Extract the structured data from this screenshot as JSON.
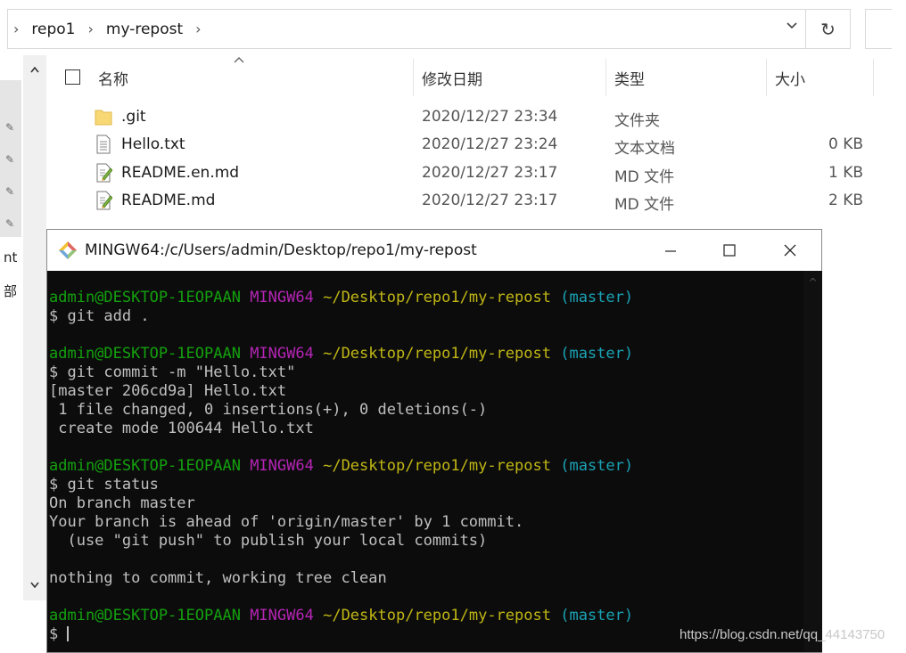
{
  "breadcrumb": [
    "repo1",
    "my-repost"
  ],
  "columns": {
    "name": "名称",
    "modified": "修改日期",
    "type": "类型",
    "size": "大小"
  },
  "files": [
    {
      "name": ".git",
      "modified": "2020/12/27 23:34",
      "type": "文件夹",
      "size": "",
      "icon": "folder-icon"
    },
    {
      "name": "Hello.txt",
      "modified": "2020/12/27 23:24",
      "type": "文本文档",
      "size": "0 KB",
      "icon": "text-file-icon"
    },
    {
      "name": "README.en.md",
      "modified": "2020/12/27 23:17",
      "type": "MD 文件",
      "size": "1 KB",
      "icon": "md-file-icon"
    },
    {
      "name": "README.md",
      "modified": "2020/12/27 23:17",
      "type": "MD 文件",
      "size": "2 KB",
      "icon": "md-file-icon"
    }
  ],
  "nav_clipped": [
    "nt",
    "部"
  ],
  "terminal": {
    "title": "MINGW64:/c/Users/admin/Desktop/repo1/my-repost",
    "prompt": {
      "user": "admin@DESKTOP-1EOPAAN",
      "env": "MINGW64",
      "path": "~/Desktop/repo1/my-repost",
      "branch": "(master)"
    },
    "lines": [
      {
        "kind": "prompt"
      },
      {
        "kind": "text",
        "text": "$ git add ."
      },
      {
        "kind": "blank"
      },
      {
        "kind": "prompt"
      },
      {
        "kind": "text",
        "text": "$ git commit -m \"Hello.txt\""
      },
      {
        "kind": "text",
        "text": "[master 206cd9a] Hello.txt"
      },
      {
        "kind": "text",
        "text": " 1 file changed, 0 insertions(+), 0 deletions(-)"
      },
      {
        "kind": "text",
        "text": " create mode 100644 Hello.txt"
      },
      {
        "kind": "blank"
      },
      {
        "kind": "prompt"
      },
      {
        "kind": "text",
        "text": "$ git status"
      },
      {
        "kind": "text",
        "text": "On branch master"
      },
      {
        "kind": "text",
        "text": "Your branch is ahead of 'origin/master' by 1 commit."
      },
      {
        "kind": "text",
        "text": "  (use \"git push\" to publish your local commits)"
      },
      {
        "kind": "blank"
      },
      {
        "kind": "text",
        "text": "nothing to commit, working tree clean"
      },
      {
        "kind": "blank"
      },
      {
        "kind": "prompt"
      },
      {
        "kind": "cursor",
        "text": "$ "
      }
    ]
  },
  "watermark": "https://blog.csdn.net/qq_44143750",
  "colors": {
    "user": "#13a10e",
    "env": "#b425b4",
    "path": "#c1b715",
    "branch": "#1aa3b5",
    "term_bg": "#0c0c0c"
  }
}
